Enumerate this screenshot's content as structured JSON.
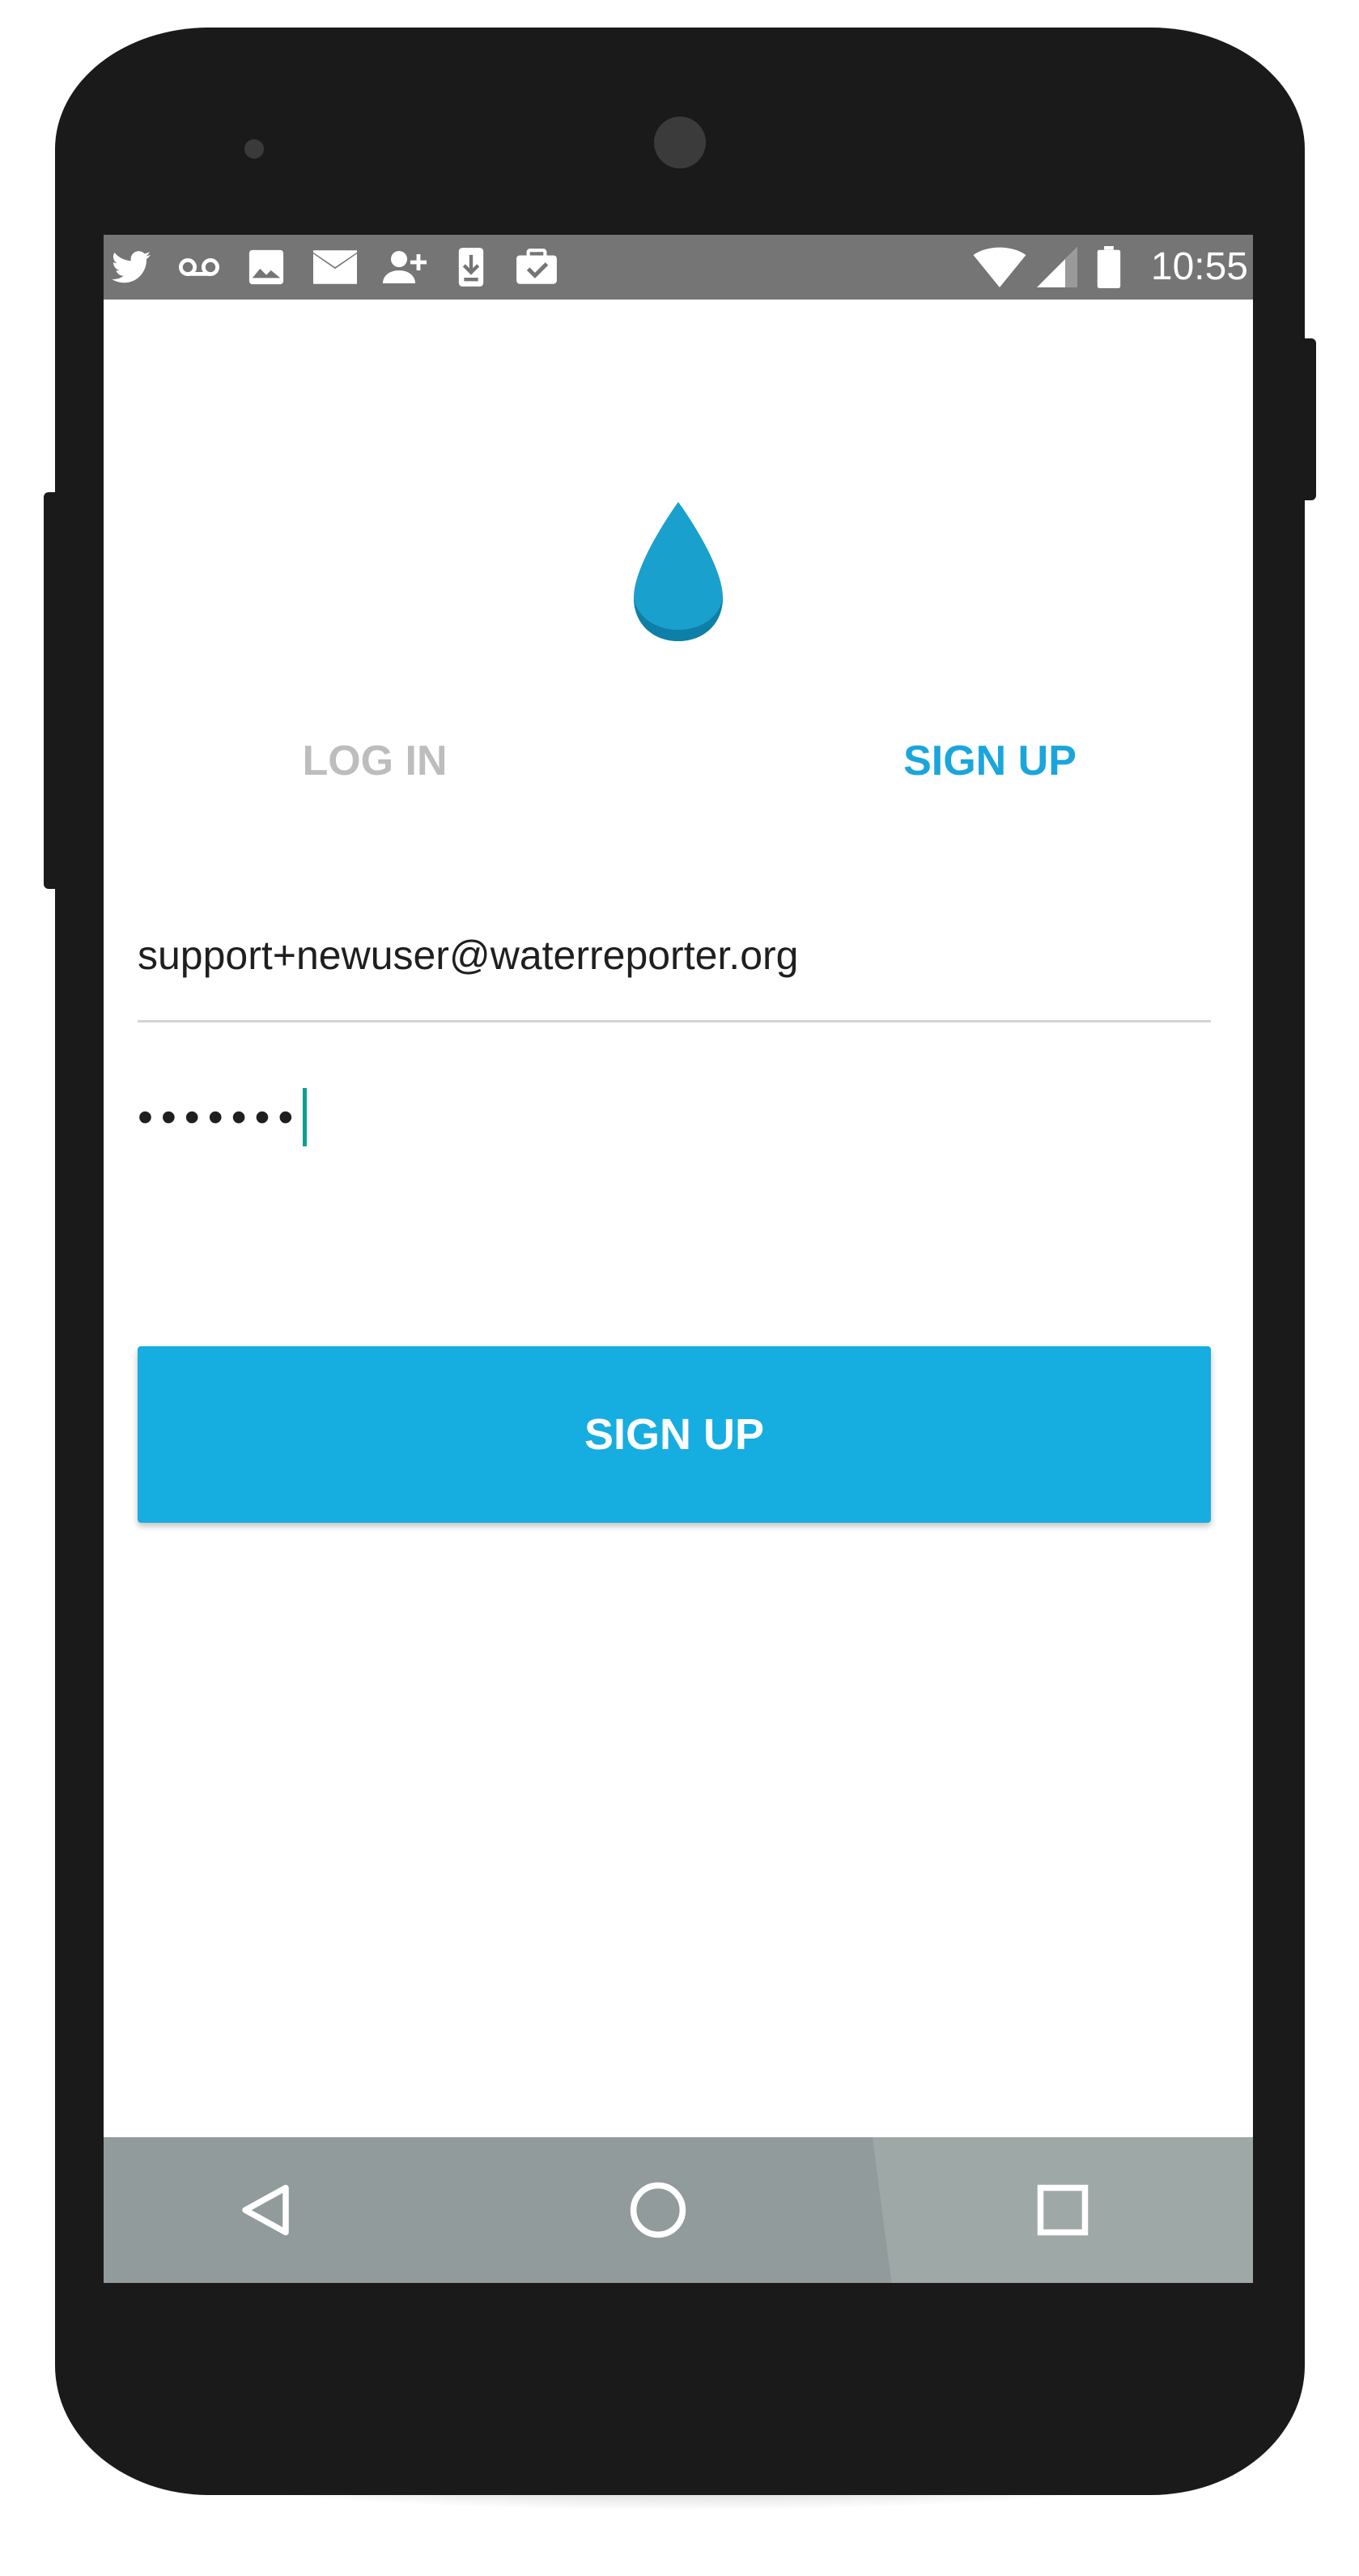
{
  "status_bar": {
    "time": "10:55",
    "left_icons": [
      "twitter-icon",
      "voicemail-icon",
      "image-icon",
      "gmail-icon",
      "add-contact-icon",
      "download-icon",
      "clipboard-check-icon"
    ],
    "right_icons": [
      "wifi-icon",
      "cell-signal-icon",
      "battery-icon"
    ],
    "color": "#757575"
  },
  "app": {
    "logo": "water-drop-icon",
    "tabs": {
      "login": "LOG IN",
      "signup": "SIGN UP",
      "active": "signup"
    },
    "email_value": "support+newuser@waterreporter.org",
    "password_value": "•••••••",
    "submit_label": "SIGN UP",
    "accent_color": "#16ade0",
    "inactive_tab_color": "#bdbdbd"
  },
  "nav_bar": {
    "buttons": [
      "back-icon",
      "home-icon",
      "recents-icon"
    ]
  }
}
